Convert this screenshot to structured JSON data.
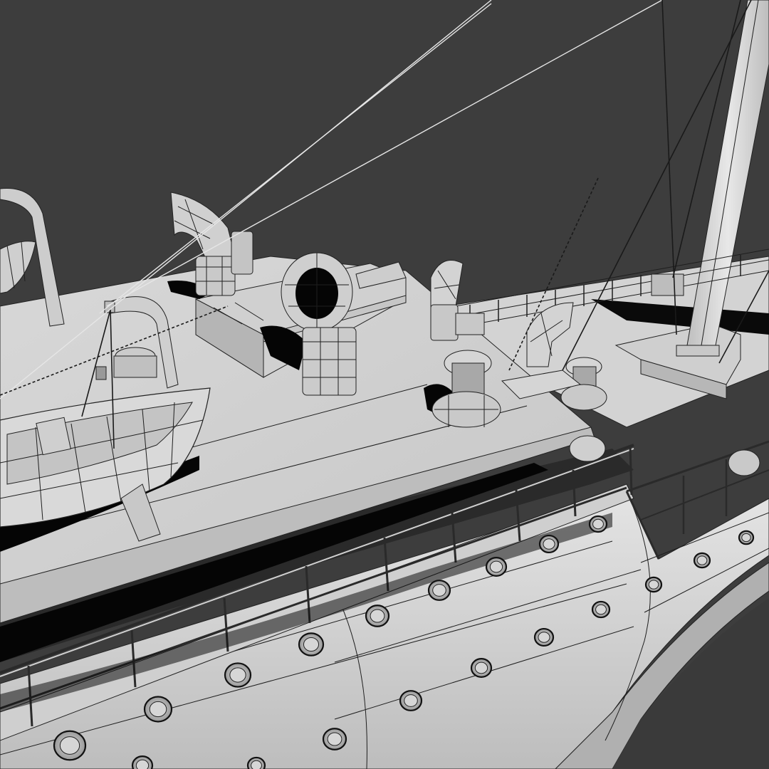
{
  "scene": {
    "subject": "ship-deck-wireframe-render",
    "colors": {
      "background": "#3d3d3d",
      "hull": "#d9d9d9",
      "deck": "#cfcfcf",
      "shadow": "#050505",
      "wire": "#1e1e1e"
    },
    "counts": {
      "portholes_visible": 22,
      "ventilators_visible": 6,
      "bollards_visible": 2,
      "lifeboats_visible": 2
    }
  }
}
